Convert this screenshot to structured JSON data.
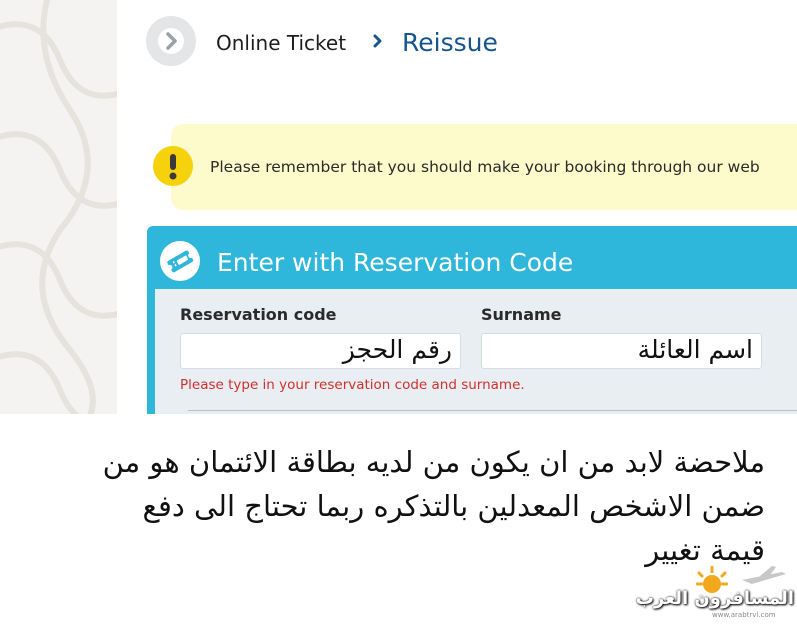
{
  "breadcrumb": {
    "back_icon": "chevron-right-icon",
    "parent": "Online Ticket",
    "separator_icon": "chevron-right-icon",
    "current": "Reissue"
  },
  "notice": {
    "icon": "exclamation-icon",
    "text": "Please remember that you should make your booking through our web"
  },
  "reservation_panel": {
    "icon": "ticket-icon",
    "title": "Enter with Reservation Code",
    "reservation_code_label": "Reservation code",
    "reservation_code_value": "رقم الحجز",
    "surname_label": "Surname",
    "surname_value": "اسم العائلة",
    "error": "Please type in your reservation code and surname."
  },
  "note": {
    "line1": "ملاحضة لابد من ان يكون من لديه بطاقة الائتمان هو من",
    "line2": "ضمن الاشخص المعدلين بالتذكره ربما تحتاج الى دفع",
    "line3": "قيمة تغيير"
  },
  "watermark": {
    "text": "المسافرون العرب",
    "url": "www.arabtrvl.com"
  },
  "colors": {
    "accent_blue": "#16548f",
    "panel_blue": "#2fb7db",
    "notice_yellow": "#fdfbcb",
    "warning_icon": "#f5d20b",
    "error_red": "#d0302f"
  }
}
